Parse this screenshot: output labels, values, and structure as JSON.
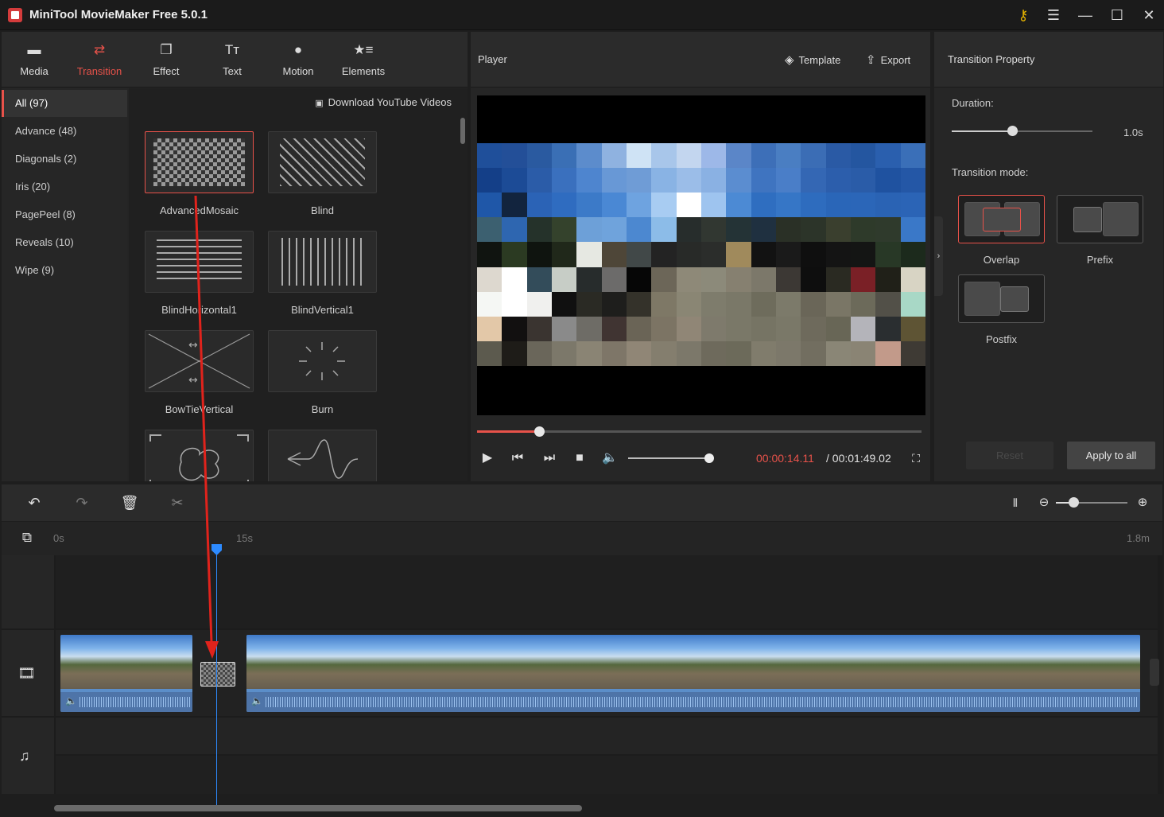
{
  "app": {
    "title": "MiniTool MovieMaker Free 5.0.1"
  },
  "window_controls": {
    "key_icon": "key-icon",
    "menu_icon": "menu-icon",
    "minimize_icon": "minimize-icon",
    "maximize_icon": "maximize-icon",
    "close_icon": "close-icon"
  },
  "top_tabs": [
    {
      "label": "Media",
      "icon": "folder-icon"
    },
    {
      "label": "Transition",
      "icon": "swap-arrows-icon",
      "active": true
    },
    {
      "label": "Effect",
      "icon": "layers-icon"
    },
    {
      "label": "Text",
      "icon": "text-icon"
    },
    {
      "label": "Motion",
      "icon": "motion-icon"
    },
    {
      "label": "Elements",
      "icon": "elements-icon"
    }
  ],
  "categories": [
    {
      "label": "All (97)",
      "active": true
    },
    {
      "label": "Advance (48)"
    },
    {
      "label": "Diagonals (2)"
    },
    {
      "label": "Iris (20)"
    },
    {
      "label": "PagePeel (8)"
    },
    {
      "label": "Reveals (10)"
    },
    {
      "label": "Wipe (9)"
    }
  ],
  "download_link": "Download YouTube Videos",
  "transitions": [
    {
      "label": "AdvancedMosaic",
      "selected": true
    },
    {
      "label": "Blind"
    },
    {
      "label": "BlindHorizontal1"
    },
    {
      "label": "BlindVertical1"
    },
    {
      "label": "BowTieVertical"
    },
    {
      "label": "Burn"
    },
    {
      "label": ""
    },
    {
      "label": ""
    }
  ],
  "player": {
    "title": "Player",
    "template_label": "Template",
    "export_label": "Export",
    "current_time": "00:00:14.11",
    "total_time": "/ 00:01:49.02",
    "progress": 0.14,
    "volume": 1.0
  },
  "property": {
    "title": "Transition Property",
    "duration_label": "Duration:",
    "duration_value": "1.0s",
    "duration_fraction": 0.43,
    "mode_label": "Transition mode:",
    "modes": [
      {
        "label": "Overlap",
        "selected": true
      },
      {
        "label": "Prefix"
      },
      {
        "label": "Postfix"
      }
    ],
    "reset_label": "Reset",
    "apply_all_label": "Apply to all"
  },
  "timeline": {
    "ruler": {
      "start": "0s",
      "mid": "15s",
      "end": "1.8m"
    },
    "tools": [
      "undo-icon",
      "redo-icon",
      "delete-icon",
      "cut-icon"
    ],
    "zoom_fraction": 0.25
  },
  "colors": {
    "accent": "#e8524a",
    "playhead": "#2d8bff",
    "clip_audio": "#4e74a8"
  }
}
